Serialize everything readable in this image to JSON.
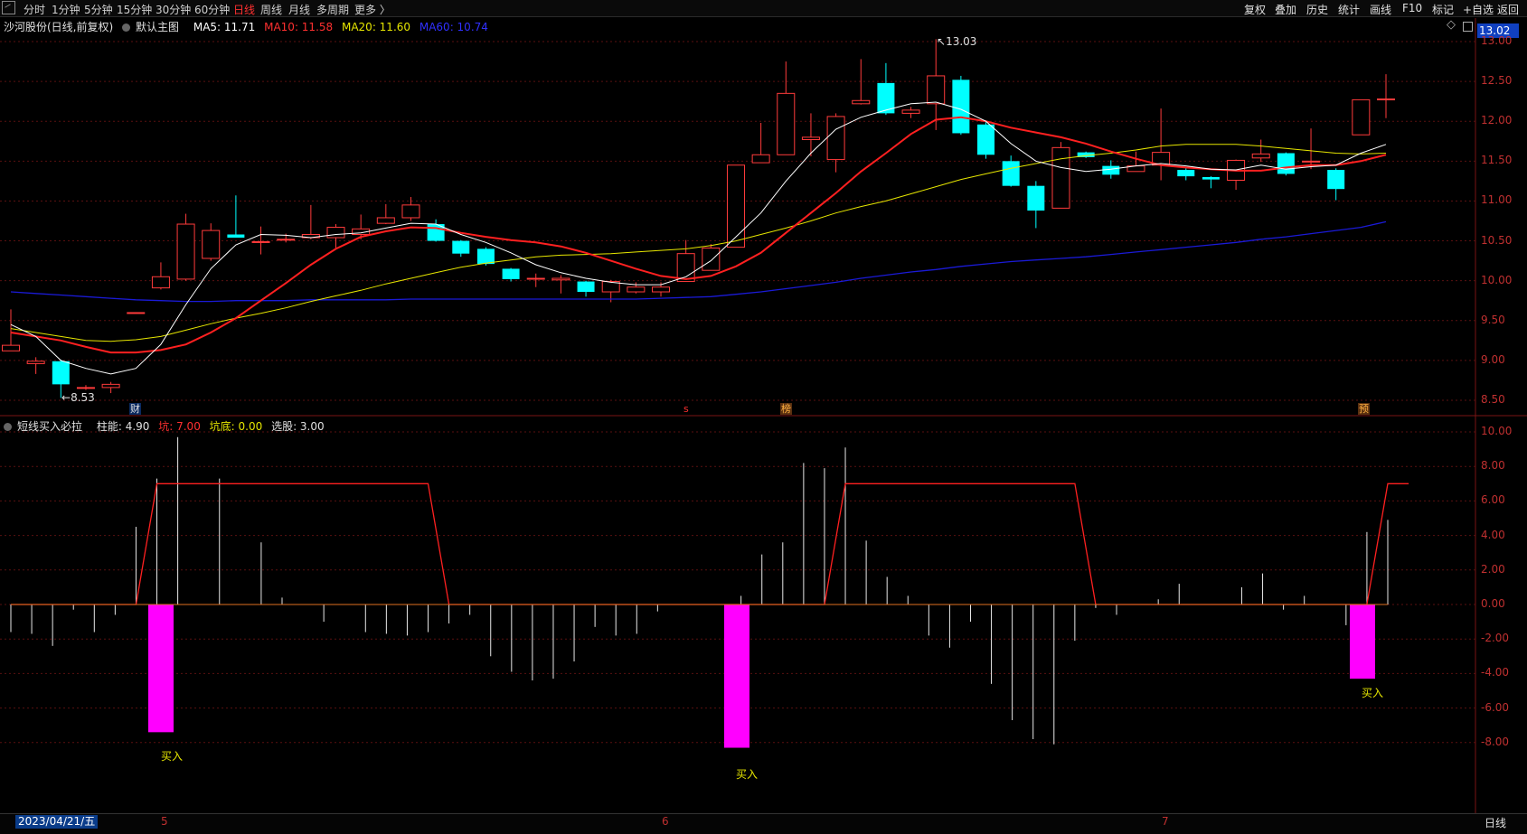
{
  "toolbar": {
    "left_items": [
      "分时",
      "1分钟",
      "5分钟",
      "15分钟",
      "30分钟",
      "60分钟",
      "日线",
      "周线",
      "月线",
      "多周期",
      "更多 〉"
    ],
    "active_index": 6,
    "right_items": [
      "复权",
      "叠加",
      "历史",
      "统计",
      "画线",
      "F10",
      "标记",
      "+自选",
      "返回"
    ]
  },
  "main_legend": {
    "stock": "沙河股份(日线,前复权)",
    "template": "默认主图",
    "ma5": "MA5: 11.71",
    "ma10": "MA10: 11.58",
    "ma20": "MA20: 11.60",
    "ma60": "MA60: 10.74"
  },
  "price_tag": "13.02",
  "annotations": {
    "high": "13.03",
    "low": "8.53"
  },
  "markers": [
    "财",
    "s",
    "榜",
    "预"
  ],
  "indicator_legend": {
    "name": "短线买入必拉",
    "zhuneng": "柱能: 4.90",
    "keng": "坑: 7.00",
    "kengdi": "坑底: 0.00",
    "xuangu": "选股: 3.00"
  },
  "buy_labels": [
    "买入",
    "买入",
    "买入"
  ],
  "bottom": {
    "date": "2023/04/21/五",
    "x_ticks": [
      "5",
      "6",
      "7"
    ],
    "period_tab": "日线"
  },
  "colors": {
    "up": "#ff3b3b",
    "down": "#00ffff",
    "ma5": "#ffffff",
    "ma10": "#ff2020",
    "ma20": "#e6e600",
    "ma60": "#1a1ad6",
    "buy_bar": "#ff00ff",
    "keng": "#ff2020",
    "grid": "#5a1010"
  },
  "chart_data": [
    {
      "type": "candlestick",
      "title": "沙河股份(日线,前复权)",
      "y_ticks": [
        "13.00",
        "12.50",
        "12.00",
        "11.50",
        "11.00",
        "10.50",
        "10.00",
        "9.50",
        "9.00",
        "8.50"
      ],
      "ylim": [
        8.4,
        13.15
      ],
      "candles": [
        [
          9.12,
          9.19,
          9.64,
          9.12
        ],
        [
          8.96,
          8.99,
          9.04,
          8.83
        ],
        [
          8.99,
          8.7,
          9.01,
          8.53
        ],
        [
          8.65,
          8.66,
          8.69,
          8.63
        ],
        [
          8.66,
          8.7,
          8.73,
          8.59
        ],
        [
          9.6,
          9.6,
          9.6,
          9.6
        ],
        [
          9.91,
          10.05,
          10.23,
          9.89
        ],
        [
          10.02,
          10.71,
          10.84,
          10.0
        ],
        [
          10.28,
          10.63,
          10.72,
          10.25
        ],
        [
          10.58,
          10.54,
          11.07,
          10.54
        ],
        [
          10.48,
          10.49,
          10.68,
          10.33
        ],
        [
          10.51,
          10.52,
          10.59,
          10.48
        ],
        [
          10.54,
          10.58,
          10.95,
          10.52
        ],
        [
          10.54,
          10.67,
          10.71,
          10.4
        ],
        [
          10.58,
          10.65,
          10.83,
          10.52
        ],
        [
          10.72,
          10.79,
          10.96,
          10.71
        ],
        [
          10.79,
          10.95,
          11.05,
          10.75
        ],
        [
          10.71,
          10.5,
          10.77,
          10.49
        ],
        [
          10.5,
          10.34,
          10.51,
          10.3
        ],
        [
          10.4,
          10.21,
          10.42,
          10.19
        ],
        [
          10.15,
          10.02,
          10.16,
          9.99
        ],
        [
          10.03,
          10.03,
          10.09,
          9.92
        ],
        [
          10.01,
          10.03,
          10.07,
          9.84
        ],
        [
          9.99,
          9.86,
          10.0,
          9.8
        ],
        [
          9.86,
          9.99,
          10.01,
          9.73
        ],
        [
          9.86,
          9.92,
          9.98,
          9.84
        ],
        [
          9.86,
          9.92,
          9.98,
          9.8
        ],
        [
          9.99,
          10.34,
          10.51,
          9.99
        ],
        [
          10.13,
          10.41,
          10.46,
          10.13
        ],
        [
          10.42,
          11.45,
          11.45,
          10.42
        ],
        [
          11.48,
          11.58,
          11.98,
          11.48
        ],
        [
          11.58,
          12.35,
          12.75,
          11.58
        ],
        [
          11.77,
          11.8,
          12.1,
          11.56
        ],
        [
          11.52,
          12.06,
          12.1,
          11.36
        ],
        [
          12.22,
          12.26,
          12.78,
          12.21
        ],
        [
          12.48,
          12.1,
          12.73,
          12.08
        ],
        [
          12.1,
          12.14,
          12.18,
          12.04
        ],
        [
          12.22,
          12.57,
          13.03,
          11.89
        ],
        [
          12.52,
          11.85,
          12.57,
          11.83
        ],
        [
          11.96,
          11.58,
          11.99,
          11.53
        ],
        [
          11.5,
          11.19,
          11.57,
          11.18
        ],
        [
          11.19,
          10.88,
          11.25,
          10.66
        ],
        [
          10.91,
          11.67,
          11.74,
          10.91
        ],
        [
          11.61,
          11.55,
          11.62,
          11.54
        ],
        [
          11.44,
          11.33,
          11.51,
          11.28
        ],
        [
          11.37,
          11.44,
          11.62,
          11.37
        ],
        [
          11.45,
          11.61,
          12.16,
          11.26
        ],
        [
          11.39,
          11.31,
          11.41,
          11.26
        ],
        [
          11.3,
          11.27,
          11.31,
          11.16
        ],
        [
          11.26,
          11.51,
          11.52,
          11.14
        ],
        [
          11.54,
          11.59,
          11.77,
          11.49
        ],
        [
          11.6,
          11.34,
          11.61,
          11.32
        ],
        [
          11.5,
          11.5,
          11.91,
          11.4
        ],
        [
          11.39,
          11.15,
          11.41,
          11.01
        ],
        [
          11.83,
          12.27,
          12.27,
          11.83
        ],
        [
          12.27,
          12.28,
          12.59,
          12.04
        ]
      ],
      "ma5": [
        9.45,
        9.3,
        9.0,
        8.9,
        8.83,
        8.9,
        9.2,
        9.7,
        10.15,
        10.45,
        10.58,
        10.57,
        10.54,
        10.58,
        10.6,
        10.66,
        10.72,
        10.71,
        10.58,
        10.48,
        10.35,
        10.2,
        10.1,
        10.03,
        9.98,
        9.95,
        9.95,
        10.05,
        10.25,
        10.55,
        10.85,
        11.25,
        11.6,
        11.9,
        12.05,
        12.14,
        12.22,
        12.24,
        12.15,
        12.0,
        11.72,
        11.5,
        11.42,
        11.37,
        11.4,
        11.44,
        11.47,
        11.44,
        11.4,
        11.39,
        11.45,
        11.4,
        11.43,
        11.45,
        11.6,
        11.71
      ],
      "ma10": [
        9.35,
        9.3,
        9.25,
        9.17,
        9.1,
        9.1,
        9.13,
        9.2,
        9.35,
        9.53,
        9.75,
        9.97,
        10.2,
        10.4,
        10.55,
        10.62,
        10.67,
        10.66,
        10.6,
        10.55,
        10.51,
        10.48,
        10.43,
        10.35,
        10.25,
        10.15,
        10.06,
        10.02,
        10.06,
        10.18,
        10.35,
        10.6,
        10.85,
        11.1,
        11.37,
        11.6,
        11.84,
        12.02,
        12.05,
        12.0,
        11.92,
        11.86,
        11.8,
        11.72,
        11.62,
        11.53,
        11.45,
        11.42,
        11.4,
        11.38,
        11.38,
        11.42,
        11.45,
        11.45,
        11.5,
        11.58
      ],
      "ma20": [
        9.4,
        9.35,
        9.3,
        9.25,
        9.24,
        9.26,
        9.3,
        9.38,
        9.46,
        9.53,
        9.59,
        9.66,
        9.74,
        9.81,
        9.88,
        9.96,
        10.03,
        10.1,
        10.17,
        10.22,
        10.26,
        10.3,
        10.32,
        10.33,
        10.34,
        10.36,
        10.38,
        10.4,
        10.44,
        10.5,
        10.58,
        10.66,
        10.75,
        10.85,
        10.93,
        11.0,
        11.09,
        11.18,
        11.27,
        11.34,
        11.41,
        11.47,
        11.53,
        11.57,
        11.6,
        11.64,
        11.69,
        11.71,
        11.71,
        11.71,
        11.69,
        11.66,
        11.63,
        11.6,
        11.59,
        11.6
      ],
      "ma60": [
        9.86,
        9.84,
        9.82,
        9.8,
        9.78,
        9.76,
        9.75,
        9.74,
        9.74,
        9.75,
        9.75,
        9.75,
        9.76,
        9.76,
        9.76,
        9.76,
        9.77,
        9.77,
        9.77,
        9.77,
        9.77,
        9.77,
        9.77,
        9.77,
        9.77,
        9.77,
        9.78,
        9.79,
        9.8,
        9.83,
        9.86,
        9.9,
        9.94,
        9.98,
        10.03,
        10.07,
        10.11,
        10.14,
        10.18,
        10.21,
        10.24,
        10.26,
        10.28,
        10.3,
        10.33,
        10.36,
        10.39,
        10.42,
        10.45,
        10.48,
        10.52,
        10.55,
        10.59,
        10.63,
        10.67,
        10.74
      ]
    },
    {
      "type": "bar",
      "title": "短线买入必拉",
      "y_ticks": [
        "10.00",
        "8.00",
        "6.00",
        "4.00",
        "2.00",
        "0.00",
        "-2.00",
        "-4.00",
        "-6.00",
        "-8.00"
      ],
      "ylim": [
        -9.5,
        10.5
      ],
      "zhuneng": [
        -1.6,
        -1.7,
        -2.4,
        -0.3,
        -1.6,
        -0.6,
        4.5,
        7.3,
        9.7,
        0.0,
        7.3,
        0.0,
        3.6,
        0.4,
        0.0,
        -1.0,
        0.0,
        -1.6,
        -1.7,
        -1.8,
        -1.6,
        -1.1,
        -0.6,
        -3.0,
        -3.9,
        -4.4,
        -4.3,
        -3.3,
        -1.3,
        -1.8,
        -1.7,
        -0.4,
        0.0,
        0.0,
        0.0,
        0.5,
        2.9,
        3.6,
        8.2,
        7.9,
        9.1,
        3.7,
        1.6,
        0.5,
        -1.8,
        -2.5,
        -1.0,
        -4.6,
        -6.7,
        -7.8,
        -8.1,
        -2.1,
        -0.2,
        -0.6,
        0.0,
        0.3,
        1.2,
        0.0,
        0.0,
        1.0,
        1.8,
        -0.3,
        0.5,
        0.0,
        -1.2,
        4.2,
        4.9
      ],
      "keng": [
        0,
        0,
        0,
        0,
        0,
        0,
        0,
        7,
        7,
        7,
        7,
        7,
        7,
        7,
        7,
        7,
        7,
        7,
        7,
        7,
        7,
        0,
        0,
        0,
        0,
        0,
        0,
        0,
        0,
        0,
        0,
        0,
        0,
        0,
        0,
        0,
        0,
        0,
        0,
        0,
        7,
        7,
        7,
        7,
        7,
        7,
        7,
        7,
        7,
        7,
        7,
        7,
        0,
        0,
        0,
        0,
        0,
        0,
        0,
        0,
        0,
        0,
        0,
        0,
        0,
        0,
        7,
        7
      ],
      "buy_values": [
        -7.4,
        -8.3,
        -4.3
      ],
      "buy_index": [
        6,
        30,
        54
      ]
    }
  ]
}
